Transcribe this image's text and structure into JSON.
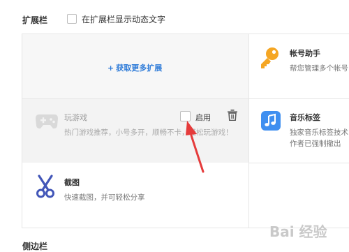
{
  "extensions_bar": {
    "title": "扩展栏",
    "show_text_option": "在扩展栏显示动态文字"
  },
  "get_more": {
    "plus": "+",
    "label": "获取更多扩展"
  },
  "cards": {
    "game": {
      "title": "玩游戏",
      "desc": "热门游戏推荐，小号多开，顺畅不卡，轻松玩游戏！",
      "enable_label": "启用"
    },
    "account": {
      "title": "帐号助手",
      "desc": "帮您管理多个帐号"
    },
    "music": {
      "title": "音乐标签",
      "desc_line1": "独家音乐标签技术",
      "desc_line2": "作者已强制撤出"
    },
    "screenshot": {
      "title": "截图",
      "desc": "快速截图，并可轻松分享"
    }
  },
  "sidebar_section": {
    "title": "侧边栏"
  },
  "watermark": {
    "text": "Bai 经验"
  },
  "colors": {
    "accent_blue": "#2e7bd8",
    "key_orange": "#f5a623",
    "music_blue": "#3f8ff0",
    "scissors_blue": "#4256b8",
    "arrow_red": "#e53b3b"
  }
}
